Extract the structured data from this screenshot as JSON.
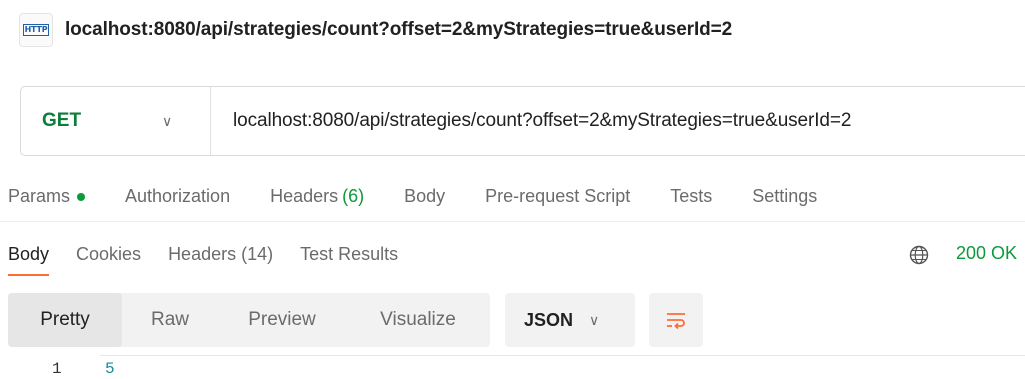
{
  "request": {
    "icon": "HTTP",
    "title": "localhost:8080/api/strategies/count?offset=2&myStrategies=true&userId=2",
    "method": "GET",
    "url": "localhost:8080/api/strategies/count?offset=2&myStrategies=true&userId=2"
  },
  "request_tabs": {
    "params": "Params",
    "authorization": "Authorization",
    "headers": "Headers",
    "headers_count": "(6)",
    "body": "Body",
    "prerequest": "Pre-request Script",
    "tests": "Tests",
    "settings": "Settings"
  },
  "response_tabs": {
    "body": "Body",
    "cookies": "Cookies",
    "headers": "Headers (14)",
    "test_results": "Test Results"
  },
  "status": "200 OK",
  "view_modes": {
    "pretty": "Pretty",
    "raw": "Raw",
    "preview": "Preview",
    "visualize": "Visualize"
  },
  "format": "JSON",
  "code": {
    "line_number": "1",
    "value": "5"
  },
  "colors": {
    "method_green": "#0c7e3a",
    "status_green": "#0c9a3c",
    "active_tab_underline": "#ff6c37",
    "wrap_icon": "#ff6c37",
    "http_icon_blue": "#1d5fa8"
  },
  "icons": {
    "http": "http-icon",
    "method_dropdown": "chevron-down-icon",
    "globe": "globe-icon",
    "format_dropdown": "chevron-down-icon",
    "wrap": "wrap-lines-icon"
  }
}
